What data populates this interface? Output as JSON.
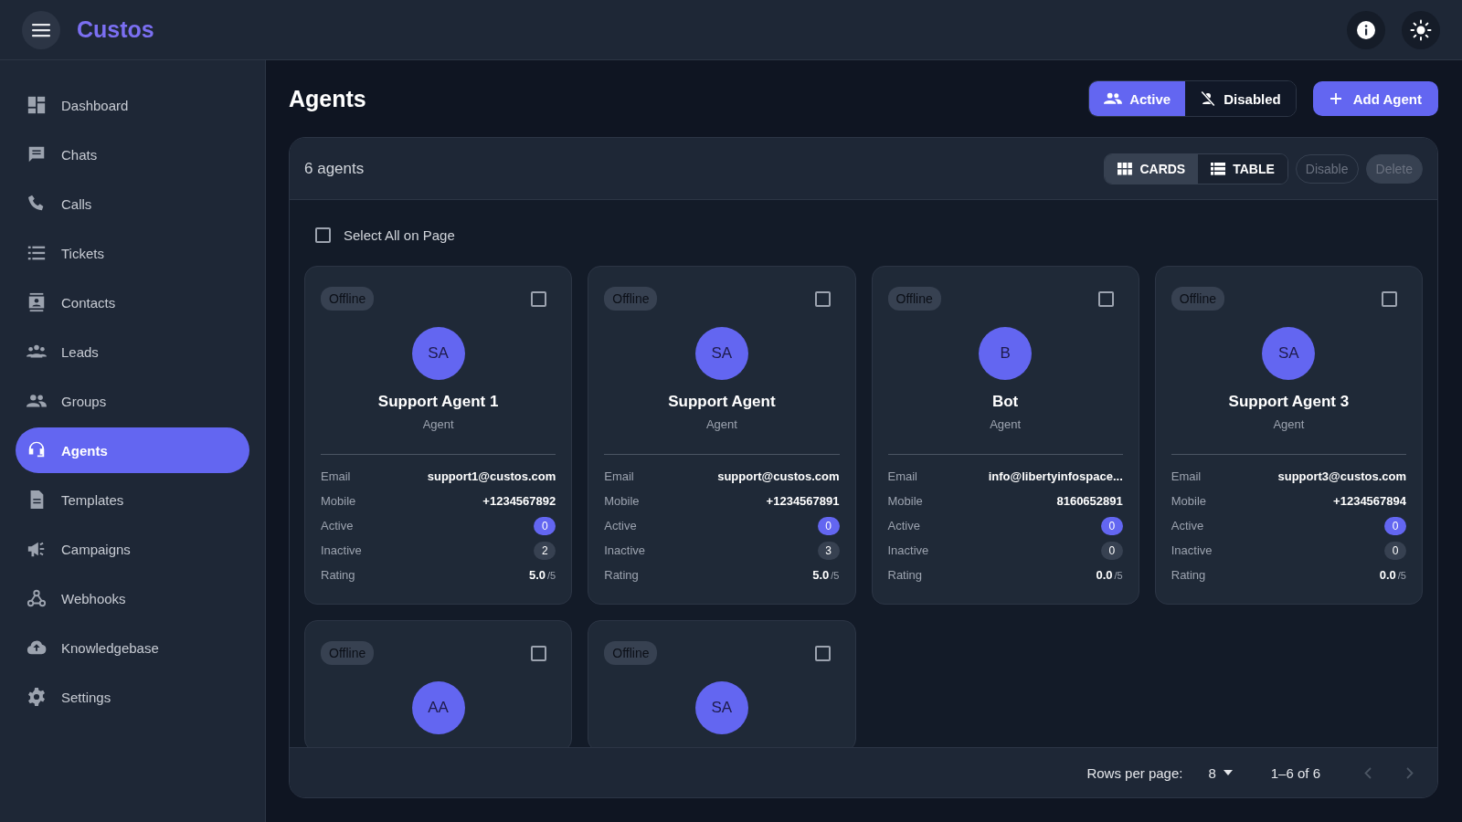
{
  "header": {
    "brand": "Custos"
  },
  "sidebar": {
    "items": [
      {
        "label": "Dashboard",
        "selected": false
      },
      {
        "label": "Chats",
        "selected": false
      },
      {
        "label": "Calls",
        "selected": false
      },
      {
        "label": "Tickets",
        "selected": false
      },
      {
        "label": "Contacts",
        "selected": false
      },
      {
        "label": "Leads",
        "selected": false
      },
      {
        "label": "Groups",
        "selected": false
      },
      {
        "label": "Agents",
        "selected": true
      },
      {
        "label": "Templates",
        "selected": false
      },
      {
        "label": "Campaigns",
        "selected": false
      },
      {
        "label": "Webhooks",
        "selected": false
      },
      {
        "label": "Knowledgebase",
        "selected": false
      },
      {
        "label": "Settings",
        "selected": false
      }
    ]
  },
  "page": {
    "title": "Agents",
    "status_filter": [
      {
        "label": "Active",
        "selected": true
      },
      {
        "label": "Disabled",
        "selected": false
      }
    ],
    "add_button": "Add Agent"
  },
  "panel": {
    "count": "6 agents",
    "view_toggle": [
      {
        "label": "CARDS",
        "selected": true
      },
      {
        "label": "TABLE",
        "selected": false
      }
    ],
    "bulk_actions": [
      {
        "label": "Disable",
        "kind": "outlined",
        "disabled": true
      },
      {
        "label": "Delete",
        "kind": "filled",
        "disabled": true
      }
    ],
    "select_all": {
      "label": "Select All on Page",
      "checked": false
    },
    "agents": [
      {
        "status": "Offline",
        "checked": false,
        "initials": "SA",
        "name": "Support Agent 1",
        "role": "Agent",
        "fields": [
          {
            "label": "Email",
            "value": "support1@custos.com"
          },
          {
            "label": "Mobile",
            "value": "+1234567892"
          }
        ],
        "active_label": "Active",
        "active": "0",
        "inactive_label": "Inactive",
        "inactive": "2",
        "rating_label": "Rating",
        "rating": "5.0",
        "rating_max": "/5"
      },
      {
        "status": "Offline",
        "checked": false,
        "initials": "SA",
        "name": "Support Agent",
        "role": "Agent",
        "fields": [
          {
            "label": "Email",
            "value": "support@custos.com"
          },
          {
            "label": "Mobile",
            "value": "+1234567891"
          }
        ],
        "active_label": "Active",
        "active": "0",
        "inactive_label": "Inactive",
        "inactive": "3",
        "rating_label": "Rating",
        "rating": "5.0",
        "rating_max": "/5"
      },
      {
        "status": "Offline",
        "checked": false,
        "initials": "B",
        "name": "Bot",
        "role": "Agent",
        "fields": [
          {
            "label": "Email",
            "value": "info@libertyinfospace..."
          },
          {
            "label": "Mobile",
            "value": "8160652891"
          }
        ],
        "active_label": "Active",
        "active": "0",
        "inactive_label": "Inactive",
        "inactive": "0",
        "rating_label": "Rating",
        "rating": "0.0",
        "rating_max": "/5"
      },
      {
        "status": "Offline",
        "checked": false,
        "initials": "SA",
        "name": "Support Agent 3",
        "role": "Agent",
        "fields": [
          {
            "label": "Email",
            "value": "support3@custos.com"
          },
          {
            "label": "Mobile",
            "value": "+1234567894"
          }
        ],
        "active_label": "Active",
        "active": "0",
        "inactive_label": "Inactive",
        "inactive": "0",
        "rating_label": "Rating",
        "rating": "0.0",
        "rating_max": "/5"
      },
      {
        "status": "Offline",
        "checked": false,
        "initials": "AA"
      },
      {
        "status": "Offline",
        "checked": false,
        "initials": "SA"
      }
    ]
  },
  "pagination": {
    "rows_label": "Rows per page:",
    "rows_value": "8",
    "range": "1–6 of 6"
  }
}
